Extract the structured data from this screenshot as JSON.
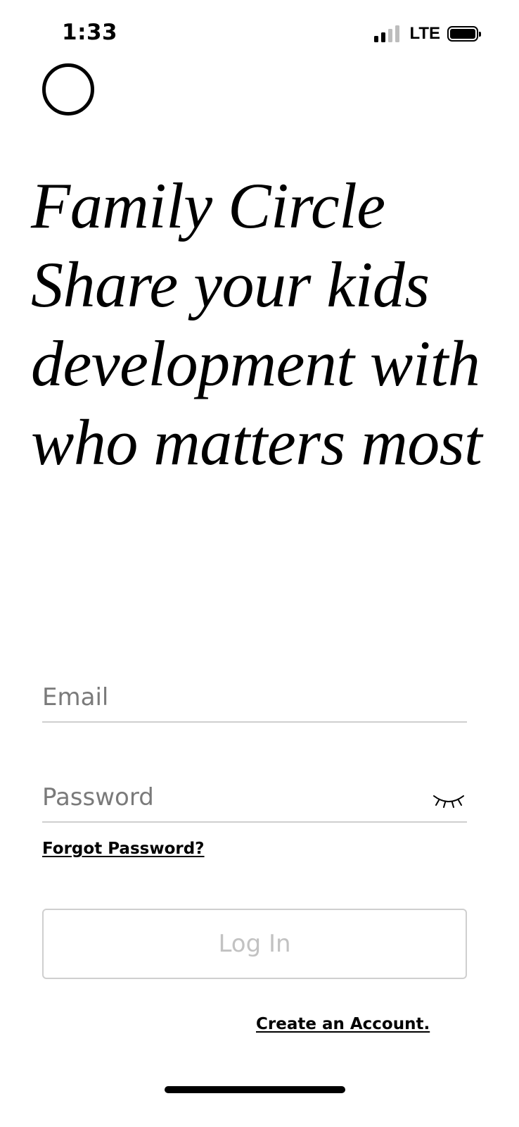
{
  "status_bar": {
    "time": "1:33",
    "network": "LTE",
    "signal_bars_active": 2,
    "signal_bars_total": 4,
    "battery_level": 1.0
  },
  "logo": {
    "icon": "circle-logo-icon"
  },
  "headline": {
    "lines": [
      "Family Circle",
      "Share your kids",
      "development with",
      "who matters most"
    ]
  },
  "form": {
    "email": {
      "placeholder": "Email",
      "value": ""
    },
    "password": {
      "placeholder": "Password",
      "value": "",
      "toggle_icon": "eye-closed-icon"
    },
    "forgot_password_label": "Forgot Password?",
    "login_label": "Log In",
    "create_account_label": "Create an Account."
  },
  "colors": {
    "text": "#000000",
    "placeholder": "#7a7a7a",
    "divider": "#cfcfcf",
    "disabled_button_text": "#c2c2c2"
  }
}
